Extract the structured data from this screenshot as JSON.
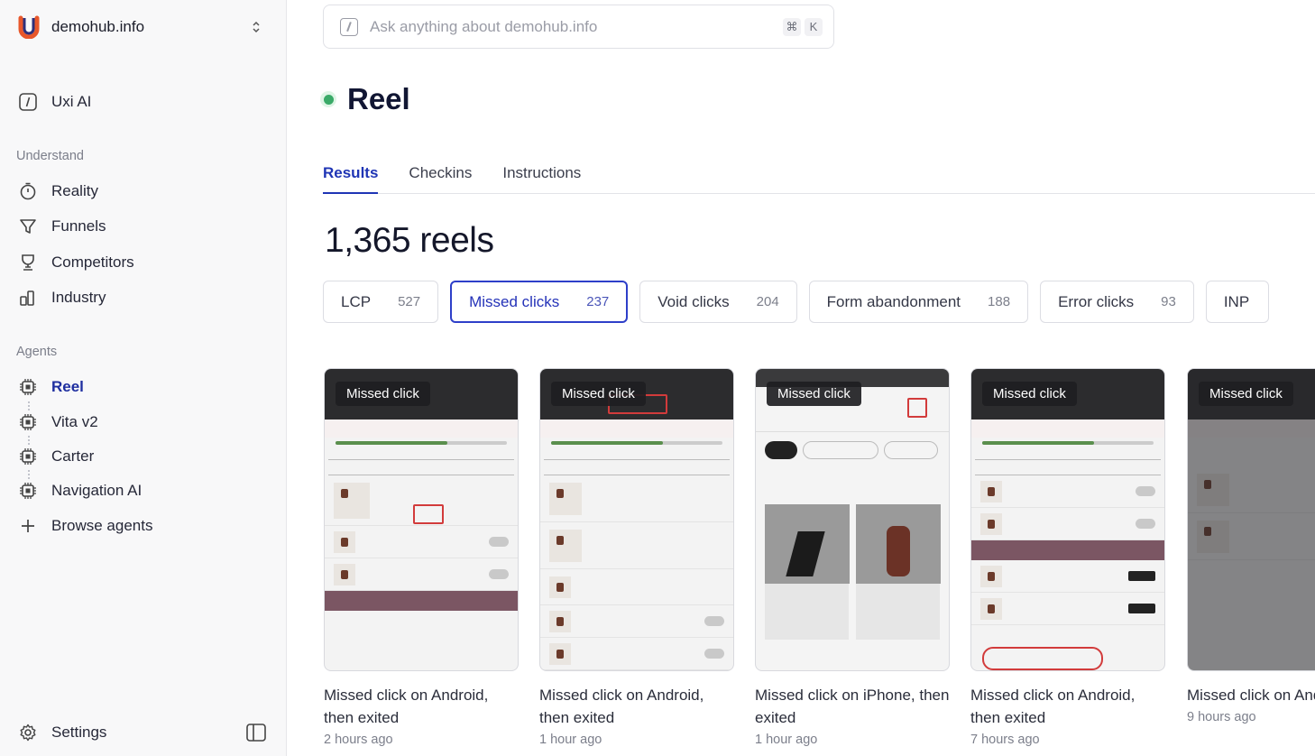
{
  "workspace": {
    "name": "demohub.info"
  },
  "sidebar": {
    "uxi_ai": "Uxi AI",
    "understand_label": "Understand",
    "understand": [
      "Reality",
      "Funnels",
      "Competitors",
      "Industry"
    ],
    "agents_label": "Agents",
    "agents": [
      "Reel",
      "Vita v2",
      "Carter",
      "Navigation AI"
    ],
    "browse": "Browse agents",
    "settings": "Settings"
  },
  "search": {
    "placeholder": "Ask anything about demohub.info",
    "key1": "⌘",
    "key2": "K"
  },
  "page": {
    "title": "Reel",
    "status_color": "#3aaa68"
  },
  "tabs": [
    "Results",
    "Checkins",
    "Instructions"
  ],
  "results": {
    "count_label": "1,365 reels"
  },
  "filters": [
    {
      "label": "LCP",
      "count": "527"
    },
    {
      "label": "Missed clicks",
      "count": "237"
    },
    {
      "label": "Void clicks",
      "count": "204"
    },
    {
      "label": "Form abandonment",
      "count": "188"
    },
    {
      "label": "Error clicks",
      "count": "93"
    },
    {
      "label": "INP",
      "count": ""
    }
  ],
  "cards": [
    {
      "badge": "Missed click",
      "title": "Missed click on Android, then exited",
      "time": "2 hours ago"
    },
    {
      "badge": "Missed click",
      "title": "Missed click on Android, then exited",
      "time": "1 hour ago"
    },
    {
      "badge": "Missed click",
      "title": "Missed click on iPhone, then exited",
      "time": "1 hour ago"
    },
    {
      "badge": "Missed click",
      "title": "Missed click on Android, then exited",
      "time": "7 hours ago"
    },
    {
      "badge": "Missed click",
      "title": "Missed click on Android, then exited",
      "time": "9 hours ago"
    }
  ],
  "colors": {
    "accent": "#1f35b5",
    "active_chip": "#2e3fc9"
  }
}
